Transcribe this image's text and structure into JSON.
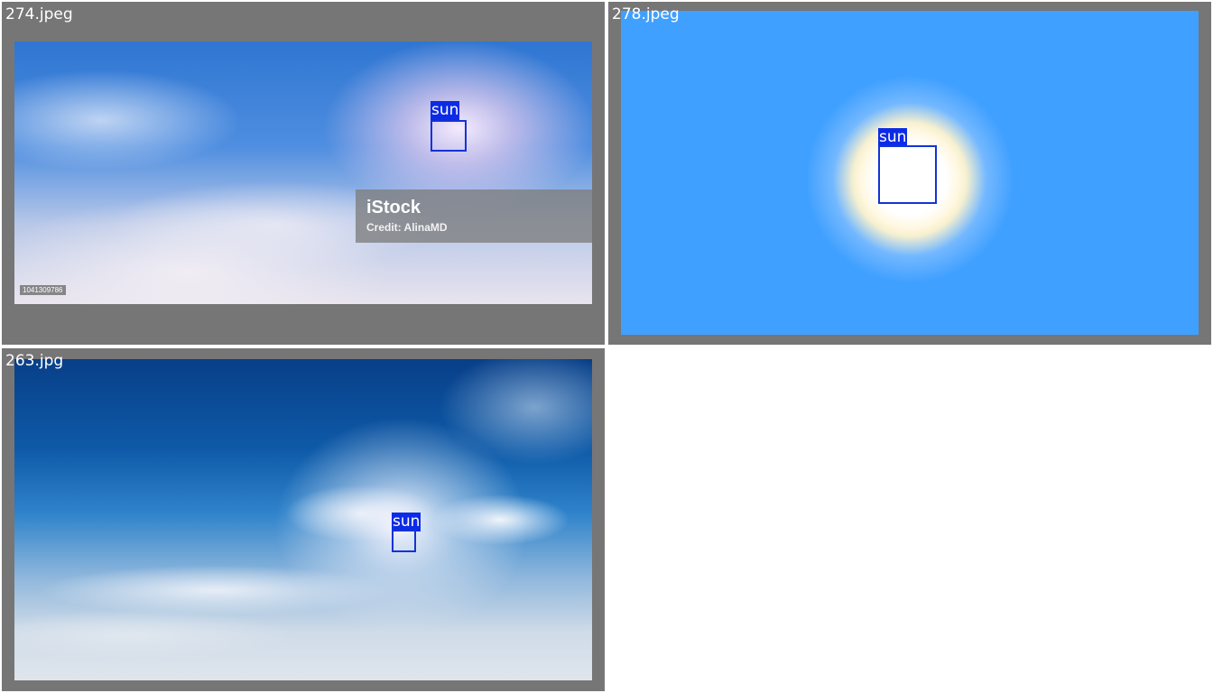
{
  "panels": [
    {
      "filename": "274.jpeg",
      "detection": {
        "label": "sun"
      },
      "watermark": {
        "brand": "iStock",
        "credit": "Credit: AlinaMD",
        "stock_id": "1041309786"
      }
    },
    {
      "filename": "278.jpeg",
      "detection": {
        "label": "sun"
      }
    },
    {
      "filename": "263.jpg",
      "detection": {
        "label": "sun"
      }
    }
  ],
  "colors": {
    "tile_background": "#767676",
    "box_border": "#1433d6",
    "label_background": "#0b2be6",
    "label_text": "#ffffff"
  }
}
